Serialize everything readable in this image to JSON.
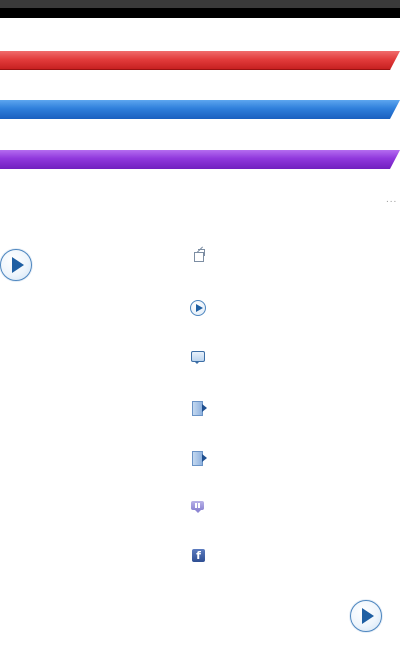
{
  "header": {
    "bar_color": "#000000",
    "stripe_color": "#3a3a3a"
  },
  "banners": [
    {
      "label": "",
      "color": "#e23b3b"
    },
    {
      "label": "",
      "color": "#2f7fdb"
    },
    {
      "label": "",
      "color": "#9038dc"
    }
  ],
  "more": {
    "label": "...",
    "icon": "more-dots-icon"
  },
  "sidebar_icons": [
    {
      "icon": "external-link-icon"
    },
    {
      "icon": "play-icon"
    },
    {
      "icon": "comment-icon"
    },
    {
      "icon": "document-play-icon"
    },
    {
      "icon": "document-play-icon"
    },
    {
      "icon": "chat-bubble-icon"
    },
    {
      "icon": "facebook-icon",
      "glyph": "f"
    }
  ],
  "players": [
    {
      "icon": "play-icon"
    },
    {
      "icon": "play-icon"
    }
  ]
}
